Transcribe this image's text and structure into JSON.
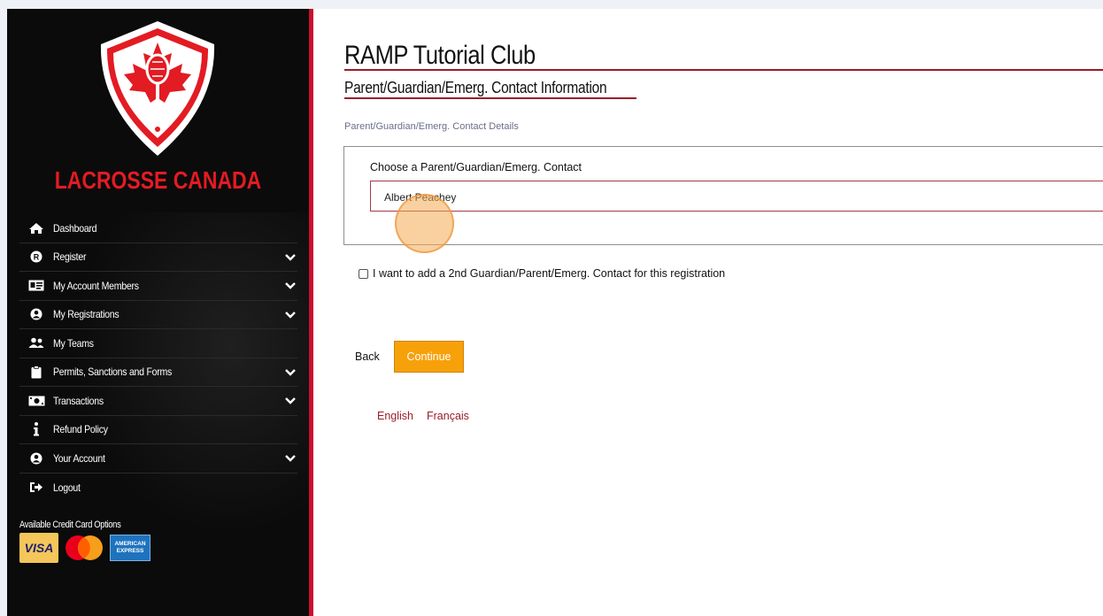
{
  "sidebar": {
    "brand": "LACROSSE CANADA",
    "items": [
      {
        "label": "Dashboard",
        "icon": "home-icon",
        "expandable": false
      },
      {
        "label": "Register",
        "icon": "r-circle-icon",
        "expandable": true
      },
      {
        "label": "My Account Members",
        "icon": "id-card-icon",
        "expandable": true
      },
      {
        "label": "My Registrations",
        "icon": "user-circle-icon",
        "expandable": true
      },
      {
        "label": "My Teams",
        "icon": "users-icon",
        "expandable": false
      },
      {
        "label": "Permits, Sanctions and Forms",
        "icon": "clipboard-icon",
        "expandable": true
      },
      {
        "label": "Transactions",
        "icon": "money-icon",
        "expandable": true
      },
      {
        "label": "Refund Policy",
        "icon": "info-icon",
        "expandable": false
      },
      {
        "label": "Your Account",
        "icon": "user-circle-icon",
        "expandable": true
      },
      {
        "label": "Logout",
        "icon": "logout-icon",
        "expandable": false
      }
    ],
    "cards_title": "Available Credit Card Options",
    "cards": {
      "visa": "VISA",
      "amex_line1": "AMERICAN",
      "amex_line2": "EXPRESS"
    }
  },
  "main": {
    "club_title": "RAMP Tutorial Club",
    "section_title": "Parent/Guardian/Emerg. Contact Information",
    "breadcrumb": "Parent/Guardian/Emerg. Contact Details",
    "select_label": "Choose a Parent/Guardian/Emerg. Contact",
    "select_value": "Albert Peachey",
    "checkbox_label": "I want to add a 2nd Guardian/Parent/Emerg. Contact for this registration",
    "back_label": "Back",
    "continue_label": "Continue",
    "lang_en": "English",
    "lang_fr": "Français"
  },
  "colors": {
    "accent_red": "#c8102e",
    "button_orange": "#f7a10a",
    "sidebar_bg": "#0b0b0b"
  }
}
